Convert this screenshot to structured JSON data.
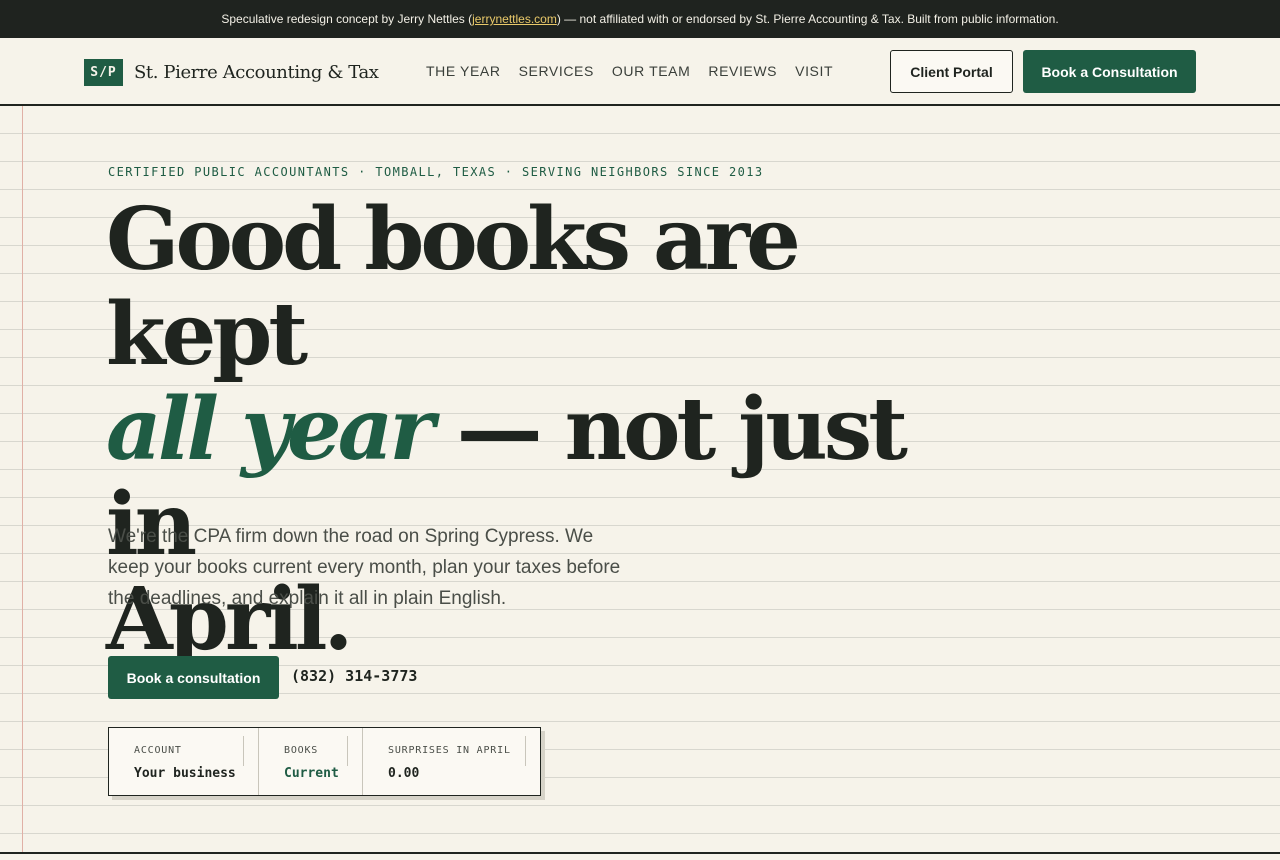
{
  "banner": {
    "prefix": "Speculative redesign concept by Jerry Nettles (",
    "link": "jerrynettles.com",
    "suffix": ") — not affiliated with or endorsed by St. Pierre Accounting & Tax. Built from public information."
  },
  "header": {
    "logo_mark": "S/P",
    "logo_name": "St. Pierre Accounting & Tax",
    "nav": [
      "THE YEAR",
      "SERVICES",
      "OUR TEAM",
      "REVIEWS",
      "VISIT"
    ],
    "portal_label": "Client Portal",
    "book_label": "Book a Consultation"
  },
  "hero": {
    "eyebrow": "CERTIFIED PUBLIC ACCOUNTANTS · TOMBALL, TEXAS · SERVING NEIGHBORS SINCE 2013",
    "headline_line1": "Good books are kept",
    "headline_accent": "all year",
    "headline_line2_rest": " — not just in",
    "headline_line3": "April.",
    "intro": "We're the CPA firm down the road on Spring Cypress. We keep your books current every month, plan your taxes before the deadlines, and explain it all in plain English.",
    "cta_label": "Book a consultation",
    "phone": "(832) 314-3773"
  },
  "ledger": [
    {
      "label": "ACCOUNT",
      "value": "Your business"
    },
    {
      "label": "BOOKS",
      "value": "Current"
    },
    {
      "label": "SURPRISES IN APRIL",
      "value": "0.00"
    }
  ],
  "colors": {
    "accent_green": "#1f5c44",
    "ink": "#1f241f",
    "paper": "#f6f3ea",
    "banner_bg": "#1f231f",
    "banner_link": "#e9c96a"
  }
}
